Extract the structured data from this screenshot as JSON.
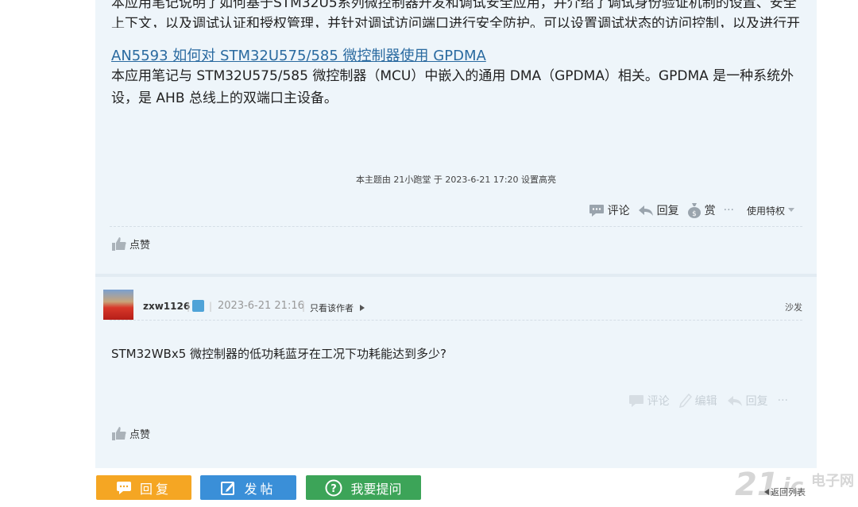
{
  "post": {
    "top_text": "本应用笔记说明了如何基于STM32U5系列微控制器开发和调试安全应用，并介绍了调试身份验证机制的设置、安全上下文，以及调试认证和授权管理，并针对调试访问端口进行安全防护。可以设置调试状态的访问控制，以及进行开发模式设置和调试管理。",
    "link_title": "AN5593 如何对 STM32U575/585 微控制器使用 GPDMA",
    "description": "本应用笔记与 STM32U575/585 微控制器（MCU）中嵌入的通用 DMA（GPDMA）相关。GPDMA 是一种系统外设，是 AHB 总线上的双端口主设备。",
    "edit_note": "本主题由 21小跑堂 于 2023-6-21 17:20 设置高亮",
    "actions": {
      "comment": "评论",
      "reply": "回复",
      "reward": "赏",
      "more": "···",
      "privileges": "使用特权"
    },
    "like": "点赞"
  },
  "reply": {
    "author": "zxw1126",
    "sep": "|",
    "time": "2023-6-21 21:16",
    "only_author": "只看该作者",
    "floor": "沙发",
    "body": "STM32WBx5 微控制器的低功耗蓝牙在工况下功耗能达到多少?",
    "actions": {
      "comment": "评论",
      "edit": "编辑",
      "reply": "回复",
      "more": "···"
    },
    "like": "点赞"
  },
  "bottom": {
    "reply_btn": "回复",
    "post_btn": "发帖",
    "ask_btn": "我要提问",
    "back_list": "返回列表"
  },
  "watermark": {
    "num": "21",
    "ic": "ic",
    "cn": "电子网"
  },
  "colors": {
    "content_bg": "#eef5fa",
    "link": "#2a6aa0",
    "reply_btn": "#f5a623",
    "post_btn": "#3a8fd8",
    "ask_btn": "#3ca458"
  }
}
